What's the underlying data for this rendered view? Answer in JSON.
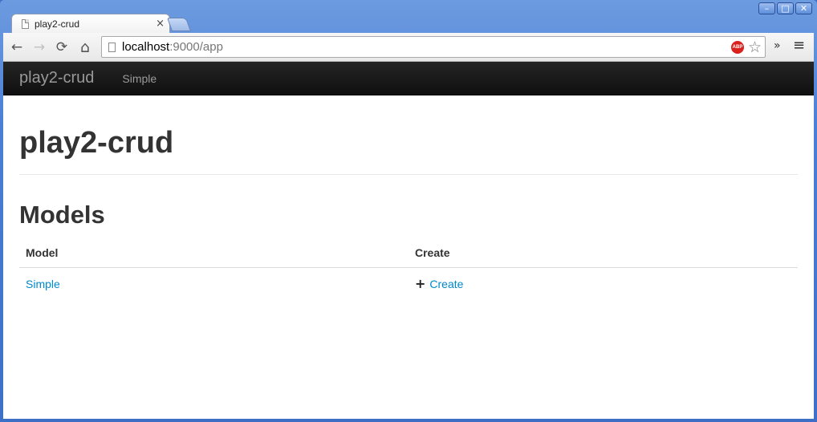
{
  "window": {
    "controls": {
      "minimize": "–",
      "maximize": "□",
      "close": "✕"
    }
  },
  "tab": {
    "title": "play2-crud",
    "close": "×"
  },
  "toolbar": {
    "back": "←",
    "forward": "→",
    "reload": "⟳",
    "home": "⌂",
    "url_host": "localhost",
    "url_rest": ":9000/app",
    "abp_label": "ABP",
    "star": "☆",
    "overflow": "»",
    "menu": "≡"
  },
  "navbar": {
    "brand": "play2-crud",
    "links": [
      "Simple"
    ]
  },
  "main": {
    "title": "play2-crud",
    "subtitle": "Models",
    "table": {
      "headers": [
        "Model",
        "Create"
      ],
      "rows": [
        {
          "model": "Simple",
          "create_icon": "+",
          "create_label": "Create"
        }
      ]
    }
  },
  "icons": {
    "page": "page-icon",
    "abp": "adblock-icon",
    "plus": "plus-icon"
  },
  "colors": {
    "link": "#0088cc",
    "navbar": "#1b1b1b",
    "heading": "#333333"
  }
}
